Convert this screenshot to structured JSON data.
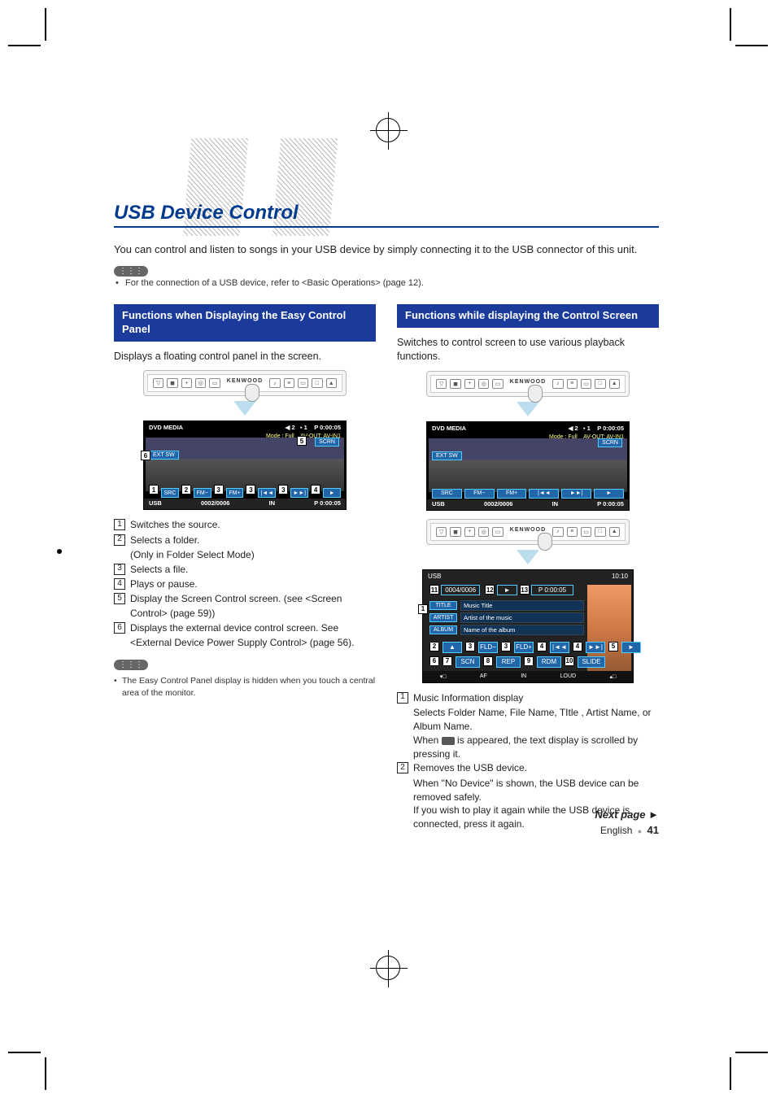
{
  "page": {
    "title": "USB Device Control",
    "intro": "You can control and listen to songs in your USB device by simply connecting it to the USB connector of this unit.",
    "note_bullet": "For the connection of a USB device, refer to <Basic Operations> (page 12).",
    "next_page": "Next page ►",
    "lang_label": "English",
    "page_number": "41"
  },
  "left": {
    "heading": "Functions when Displaying the Easy Control Panel",
    "lead": "Displays a floating control panel in the screen.",
    "top_bar_brand": "KENWOOD",
    "dvd": {
      "label": "DVD MEDIA",
      "track_icon": "2",
      "disc_icon": "1",
      "time": "P 0:00:05",
      "mode": "Mode : Full",
      "avout": "AV-OUT: AV-IN1",
      "scrn": "SCRN",
      "ext": "EXT SW",
      "buttons": {
        "src": "SRC",
        "fm": "FM−",
        "fp": "FM+",
        "prev": "|◄◄",
        "next": "►►|",
        "play": "►"
      },
      "callouts": {
        "src": "1",
        "fm": "2",
        "fp": "3",
        "prev": "3",
        "next": "3",
        "play": "4",
        "scrn": "5",
        "ext": "6"
      },
      "usb_label": "USB",
      "usb_counter": "0002/0006",
      "usb_mode": "IN",
      "usb_time": "P   0:00:05"
    },
    "items": {
      "1": "Switches the source.",
      "2": "Selects a folder.",
      "2_sub": "(Only in Folder Select Mode)",
      "3": "Selects a file.",
      "4": "Plays or pause.",
      "5": "Display the Screen Control screen. (see <Screen Control> (page 59))",
      "6": "Displays the external device control screen. See <External Device Power Supply Control> (page 56)."
    },
    "footnote": "The Easy Control Panel display is hidden when you touch a central area of the monitor."
  },
  "right": {
    "heading": "Functions while displaying the Control Screen",
    "lead": "Switches to control screen to use various playback functions.",
    "top_bar_brand": "KENWOOD",
    "dvd": {
      "label": "DVD MEDIA",
      "track_icon": "2",
      "disc_icon": "1",
      "time": "P 0:00:05",
      "mode": "Mode : Full",
      "avout": "AV-OUT: AV-IN1",
      "scrn": "SCRN",
      "ext": "EXT SW",
      "usb_label": "USB",
      "usb_counter": "0002/0006",
      "usb_mode": "IN",
      "usb_time": "P   0:00:05"
    },
    "usb_ctl": {
      "title": "USB",
      "clock": "10:10",
      "counter": "0004/0006",
      "play_icon": "►",
      "time": "P   0:00:05",
      "title_lbl": "TITLE",
      "title_val": "Music Title",
      "artist_lbl": "ARTIST",
      "artist_val": "Artist of the music",
      "album_lbl": "ALBUM",
      "album_val": "Name of the album",
      "transport": {
        "eject": "▲",
        "fm": "FLD−",
        "fp": "FLD+",
        "prev": "|◄◄",
        "next": "►►|",
        "play": "►"
      },
      "modes": {
        "scn": "SCN",
        "rep": "REP",
        "rdm": "RDM",
        "slide": "SLIDE"
      },
      "bottom": {
        "af": "AF",
        "in": "IN",
        "loud": "LOUD"
      },
      "callouts": {
        "info": "1",
        "eject": "2",
        "fm": "3",
        "fp": "3",
        "prev": "4",
        "next": "4",
        "play": "5",
        "scn_l": "6",
        "scn": "7",
        "rep": "8",
        "rdm": "9",
        "slide": "10",
        "counter": "11",
        "playicon": "12",
        "time": "13"
      }
    },
    "items": {
      "1_a": "Music Information display",
      "1_b": "Selects Folder Name, File Name, TItle , Artist Name, or Album Name.",
      "1_c_pre": "When ",
      "1_c_post": " is appeared, the text display is scrolled by pressing it.",
      "2_a": "Removes the USB device.",
      "2_b": "When \"No Device\" is shown, the USB device can be removed safely.",
      "2_c": "If you wish to play it again while the USB device is connected, press it again."
    }
  }
}
